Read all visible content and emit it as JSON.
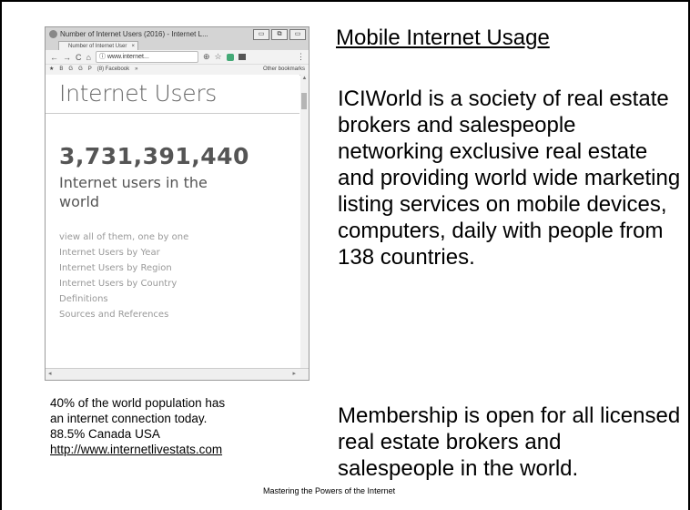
{
  "browser": {
    "window_title": "Number of Internet Users (2016) - Internet L...",
    "window_buttons": [
      "▭",
      "⧉",
      "▭"
    ],
    "tab_label": "Number of Internet User",
    "tab_close": "×",
    "nav_back": "←",
    "nav_forward": "→",
    "nav_reload": "C",
    "nav_home": "⌂",
    "address": "ⓘ www.internet...",
    "zoom_icon": "⊕",
    "star_icon": "☆",
    "menu_icon": "⋮",
    "bookmarks": [
      "★",
      "B",
      "G",
      "G",
      "P",
      "(8) Facebook",
      "»"
    ],
    "other_bookmarks": "Other bookmarks",
    "page": {
      "heading": "Internet Users",
      "count": "3,731,391,440",
      "count_caption": "Internet users in the world",
      "links": [
        "view all of them, one by one",
        "Internet Users by Year",
        "Internet Users by Region",
        "Internet Users by Country",
        "Definitions",
        "Sources and References"
      ]
    },
    "scroll_up": "▲",
    "scroll_left": "◂",
    "scroll_right": "▸"
  },
  "slide": {
    "heading": "Mobile Internet Usage",
    "paragraph1": "ICIWorld is a society of real estate brokers and salespeople networking exclusive real estate and providing world wide marketing listing services on mobile devices, computers, daily with people from 138 countries.",
    "paragraph2": "Membership is open for all licensed real estate brokers and salespeople in the world.",
    "caption_lines": [
      "40% of the world population has",
      "an internet connection today.",
      "88.5% Canada USA"
    ],
    "caption_link": "http://www.internetlivestats.com",
    "footer": "Mastering the Powers of the Internet"
  }
}
